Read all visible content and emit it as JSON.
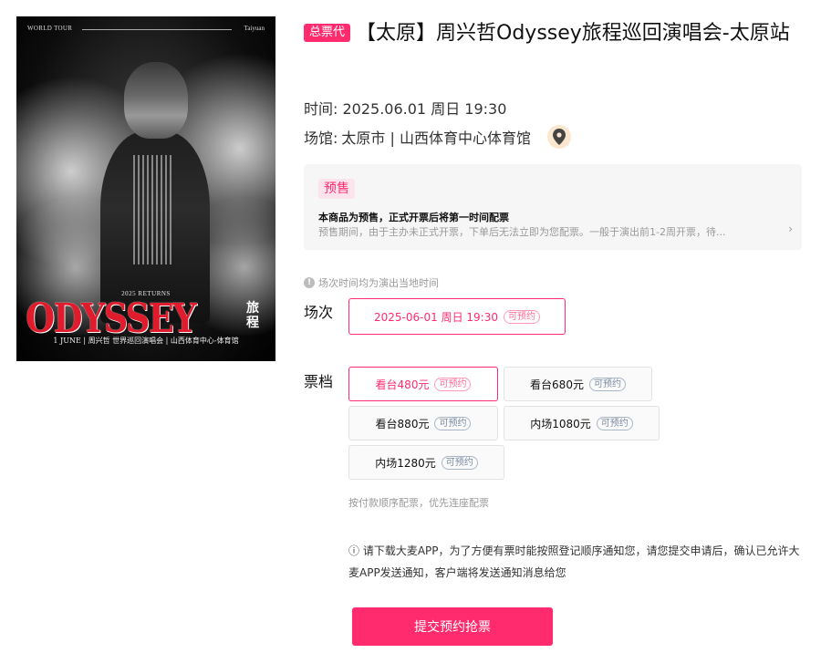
{
  "poster": {
    "world_tour": "WORLD TOUR",
    "city": "Taiyuan",
    "returns": "2025 RETURNS",
    "headline": "ODYSSEY",
    "headline_cn": "旅程",
    "info_line": "1 JUNE | 周兴哲 世界巡回演唱会 | 山西体育中心-体育馆"
  },
  "title": {
    "badge": "总票代",
    "text": "【太原】周兴哲Odyssey旅程巡回演唱会-太原站"
  },
  "meta": {
    "time_label": "时间:",
    "time_value": "2025.06.01 周日 19:30",
    "venue_label": "场馆:",
    "venue_value": "太原市 | 山西体育中心体育馆",
    "venue_icon": "map-pin-icon"
  },
  "presale": {
    "tag": "预售",
    "line1": "本商品为预售，正式开票后将第一时间配票",
    "line2": "预售期间，由于主办未正式开票，下单后无法立即为您配票。一般于演出前1-2周开票，待...",
    "arrow": "›"
  },
  "tz_note": "场次时间均为演出当地时间",
  "session": {
    "label": "场次",
    "options": [
      {
        "text": "2025-06-01 周日 19:30",
        "tag": "可预约",
        "selected": true
      }
    ]
  },
  "tiers": {
    "label": "票档",
    "options": [
      {
        "text": "看台480元",
        "tag": "可预约",
        "selected": true
      },
      {
        "text": "看台680元",
        "tag": "可预约",
        "selected": false
      },
      {
        "text": "看台880元",
        "tag": "可预约",
        "selected": false
      },
      {
        "text": "内场1080元",
        "tag": "可预约",
        "selected": false
      },
      {
        "text": "内场1280元",
        "tag": "可预约",
        "selected": false
      }
    ]
  },
  "seat_note": "按付款顺序配票，优先连座配票",
  "app_note": "ⓘ 请下载大麦APP，为了方便有票时能按照登记顺序通知您，请您提交申请后，确认已允许大麦APP发送通知，客户端将发送通知消息给您",
  "submit_label": "提交预约抢票",
  "colors": {
    "accent": "#ff2b6e",
    "accent_light": "#fde4ec",
    "pin_bg": "#fbe7cf"
  }
}
